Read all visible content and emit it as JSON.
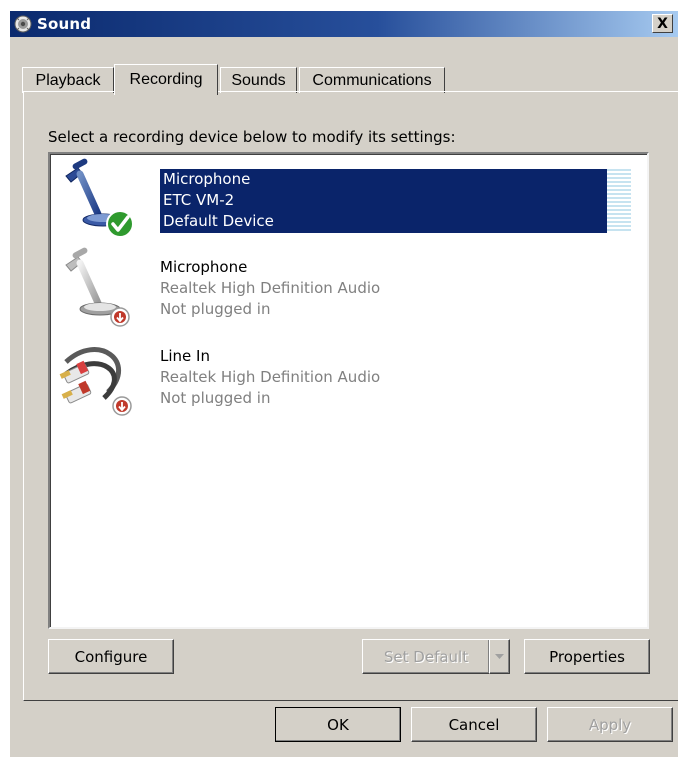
{
  "window": {
    "title": "Sound",
    "close_label": "X"
  },
  "tabs": [
    {
      "label": "Playback",
      "active": false
    },
    {
      "label": "Recording",
      "active": true
    },
    {
      "label": "Sounds",
      "active": false
    },
    {
      "label": "Communications",
      "active": false
    }
  ],
  "instruction": "Select a recording device below to modify its settings:",
  "devices": [
    {
      "name": "Microphone",
      "driver": "ETC VM-2",
      "status": "Default Device",
      "icon": "microphone-default-icon",
      "selected": true
    },
    {
      "name": "Microphone",
      "driver": "Realtek High Definition Audio",
      "status": "Not plugged in",
      "icon": "microphone-unplugged-icon",
      "selected": false
    },
    {
      "name": "Line In",
      "driver": "Realtek High Definition Audio",
      "status": "Not plugged in",
      "icon": "line-in-unplugged-icon",
      "selected": false
    }
  ],
  "buttons": {
    "configure": "Configure",
    "set_default": "Set Default",
    "properties": "Properties",
    "ok": "OK",
    "cancel": "Cancel",
    "apply": "Apply"
  },
  "colors": {
    "selection": "#0a246a",
    "face": "#d4d0c8",
    "disabled_text": "#a0a0a0",
    "level_meter": "#c6e3f0"
  }
}
